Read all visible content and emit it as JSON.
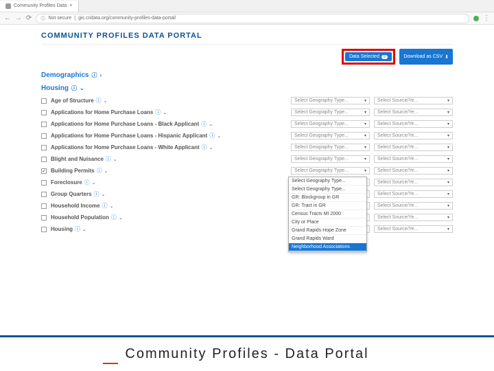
{
  "chrome": {
    "tab_title": "Community Profiles Data",
    "secure_label": "Not secure",
    "url": "gis.cridata.org/community-profiles-data-portal/"
  },
  "portal": {
    "title": "COMMUNITY PROFILES DATA PORTAL"
  },
  "actions": {
    "data_selected_label": "Data Selected",
    "data_selected_count": "0",
    "download_label": "Download as CSV"
  },
  "sections": {
    "demographics": "Demographics",
    "housing": "Housing"
  },
  "placeholders": {
    "geo": "Select Geography Type...",
    "src": "Select Source/Ye..."
  },
  "rows": [
    {
      "label": "Age of Structure"
    },
    {
      "label": "Applications for Home Purchase Loans"
    },
    {
      "label": "Applications for Home Purchase Loans - Black Applicant"
    },
    {
      "label": "Applications for Home Purchase Loans - Hispanic Applicant"
    },
    {
      "label": "Applications for Home Purchase Loans - White Applicant"
    },
    {
      "label": "Blight and Nuisance"
    },
    {
      "label": "Building Permits",
      "checked": true,
      "open": true
    },
    {
      "label": "Foreclosure"
    },
    {
      "label": "Group Quarters"
    },
    {
      "label": "Household Income"
    },
    {
      "label": "Household Population"
    },
    {
      "label": "Housing"
    }
  ],
  "dropdown": [
    "Select Geography Type...",
    "Select Geography Type...",
    "GR: Blockgroup in GR",
    "GR: Tract in GR",
    "Census Tracts MI 2000",
    "City or Place",
    "Grand Rapids Hope Zone",
    "Grand Rapids Ward",
    "Neighborhood Associations"
  ],
  "footer": {
    "caption": "Community Profiles - Data Portal"
  }
}
